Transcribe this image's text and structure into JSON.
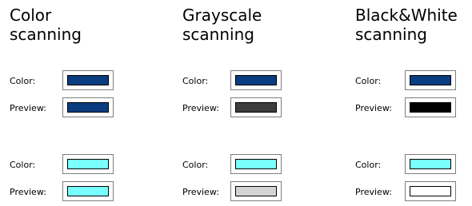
{
  "columns": [
    {
      "title": "Color\nscanning",
      "groups": [
        {
          "rows": [
            {
              "label": "Color:",
              "swatch_color": "#0a3d7f"
            },
            {
              "label": "Preview:",
              "swatch_color": "#0a3d7f"
            }
          ]
        },
        {
          "rows": [
            {
              "label": "Color:",
              "swatch_color": "#7affff"
            },
            {
              "label": "Preview:",
              "swatch_color": "#7affff"
            }
          ]
        }
      ]
    },
    {
      "title": "Grayscale\nscanning",
      "groups": [
        {
          "rows": [
            {
              "label": "Color:",
              "swatch_color": "#0a3d7f"
            },
            {
              "label": "Preview:",
              "swatch_color": "#3d3d3d"
            }
          ]
        },
        {
          "rows": [
            {
              "label": "Color:",
              "swatch_color": "#7affff"
            },
            {
              "label": "Preview:",
              "swatch_color": "#d4d4d4"
            }
          ]
        }
      ]
    },
    {
      "title": "Black&White\nscanning",
      "groups": [
        {
          "rows": [
            {
              "label": "Color:",
              "swatch_color": "#0a3d7f"
            },
            {
              "label": "Preview:",
              "swatch_color": "#000000"
            }
          ]
        },
        {
          "rows": [
            {
              "label": "Color:",
              "swatch_color": "#7affff"
            },
            {
              "label": "Preview:",
              "swatch_color": "#ffffff"
            }
          ]
        }
      ]
    }
  ]
}
